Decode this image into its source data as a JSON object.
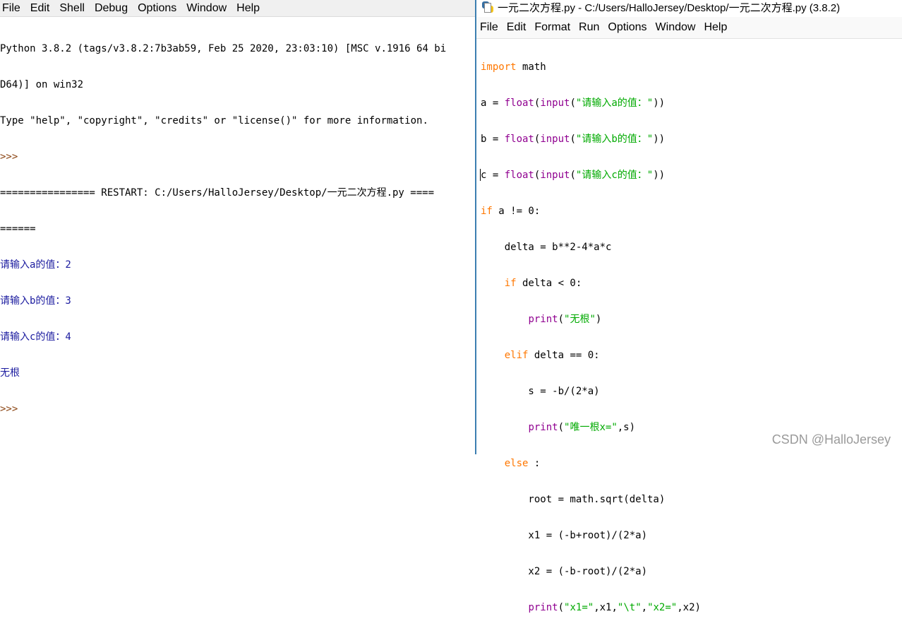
{
  "shell": {
    "menu": [
      "File",
      "Edit",
      "Shell",
      "Debug",
      "Options",
      "Window",
      "Help"
    ],
    "banner_1": "Python 3.8.2 (tags/v3.8.2:7b3ab59, Feb 25 2020, 23:03:10) [MSC v.1916 64 bi",
    "banner_2": "D64)] on win32",
    "banner_3": "Type \"help\", \"copyright\", \"credits\" or \"license()\" for more information.",
    "prompt": ">>>",
    "restart_1": "================ RESTART: C:/Users/HalloJersey/Desktop/一元二次方程.py ====",
    "restart_2": "======",
    "output": [
      "请输入a的值：2",
      "请输入b的值：3",
      "请输入c的值：4",
      "无根"
    ]
  },
  "editor": {
    "title": "一元二次方程.py - C:/Users/HalloJersey/Desktop/一元二次方程.py (3.8.2)",
    "menu": [
      "File",
      "Edit",
      "Format",
      "Run",
      "Options",
      "Window",
      "Help"
    ],
    "code": {
      "l1_kw": "import",
      "l1_rest": " math",
      "a_pre": "a = ",
      "b_pre": "b = ",
      "c_pre": "c = ",
      "float": "float",
      "input": "input",
      "paren_open": "(",
      "paren_close": "))",
      "prompt_a": "\"请输入a的值：\"",
      "prompt_b": "\"请输入b的值：\"",
      "prompt_c": "\"请输入c的值：\"",
      "if_kw": "if",
      "if_rest": " a != 0:",
      "delta": "    delta = b**2-4*a*c",
      "if2_indent": "    ",
      "if2_rest": " delta < 0:",
      "print_indent": "        ",
      "print": "print",
      "print1_str": "\"无根\"",
      "close": ")",
      "elif_indent": "    ",
      "elif_kw": "elif",
      "elif_rest": " delta == 0:",
      "s_line": "        s = -b/(2*a)",
      "print2_str": "\"唯一根x=\"",
      "print2_rest": ",s)",
      "else_indent": "    ",
      "else_kw": "else",
      "else_rest": " :",
      "root_line": "        root = math.sqrt(delta)",
      "x1_line": "        x1 = (-b+root)/(2*a)",
      "x2_line": "        x2 = (-b-root)/(2*a)",
      "p3_s1": "\"x1=\"",
      "p3_m1": ",x1,",
      "p3_s2": "\"\\t\"",
      "p3_m2": ",",
      "p3_s3": "\"x2=\"",
      "p3_end": ",x2)"
    }
  },
  "watermark": "CSDN @HalloJersey",
  "colors": {
    "keyword": "#ff7700",
    "builtin": "#900090",
    "string": "#00aa00",
    "shell_output": "#1b1b9f"
  }
}
